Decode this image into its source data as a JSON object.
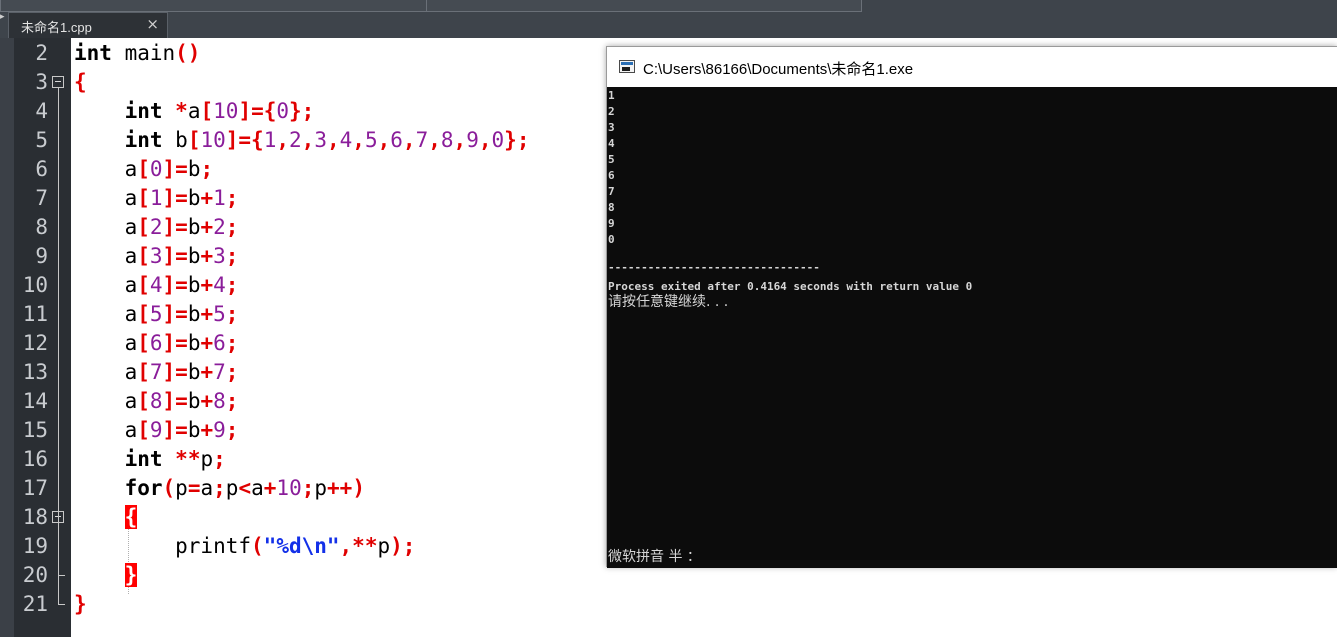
{
  "tab": {
    "label": "未命名1.cpp",
    "close": "×",
    "arrow": "▸"
  },
  "editor": {
    "line_numbers": [
      "2",
      "3",
      "4",
      "5",
      "6",
      "7",
      "8",
      "9",
      "10",
      "11",
      "12",
      "13",
      "14",
      "15",
      "16",
      "17",
      "18",
      "19",
      "20",
      "21"
    ],
    "lines": [
      [
        {
          "t": "int",
          "c": "kw"
        },
        {
          "t": " main",
          "c": ""
        },
        {
          "t": "()",
          "c": "sym"
        }
      ],
      [
        {
          "t": "{",
          "c": "sym"
        }
      ],
      [
        {
          "t": "    ",
          "c": ""
        },
        {
          "t": "int",
          "c": "kw"
        },
        {
          "t": " ",
          "c": ""
        },
        {
          "t": "*",
          "c": "sym"
        },
        {
          "t": "a",
          "c": ""
        },
        {
          "t": "[",
          "c": "sym"
        },
        {
          "t": "10",
          "c": "num"
        },
        {
          "t": "]={",
          "c": "sym"
        },
        {
          "t": "0",
          "c": "num"
        },
        {
          "t": "};",
          "c": "sym"
        }
      ],
      [
        {
          "t": "    ",
          "c": ""
        },
        {
          "t": "int",
          "c": "kw"
        },
        {
          "t": " b",
          "c": ""
        },
        {
          "t": "[",
          "c": "sym"
        },
        {
          "t": "10",
          "c": "num"
        },
        {
          "t": "]={",
          "c": "sym"
        },
        {
          "t": "1",
          "c": "num"
        },
        {
          "t": ",",
          "c": "sym"
        },
        {
          "t": "2",
          "c": "num"
        },
        {
          "t": ",",
          "c": "sym"
        },
        {
          "t": "3",
          "c": "num"
        },
        {
          "t": ",",
          "c": "sym"
        },
        {
          "t": "4",
          "c": "num"
        },
        {
          "t": ",",
          "c": "sym"
        },
        {
          "t": "5",
          "c": "num"
        },
        {
          "t": ",",
          "c": "sym"
        },
        {
          "t": "6",
          "c": "num"
        },
        {
          "t": ",",
          "c": "sym"
        },
        {
          "t": "7",
          "c": "num"
        },
        {
          "t": ",",
          "c": "sym"
        },
        {
          "t": "8",
          "c": "num"
        },
        {
          "t": ",",
          "c": "sym"
        },
        {
          "t": "9",
          "c": "num"
        },
        {
          "t": ",",
          "c": "sym"
        },
        {
          "t": "0",
          "c": "num"
        },
        {
          "t": "};",
          "c": "sym"
        }
      ],
      [
        {
          "t": "    a",
          "c": ""
        },
        {
          "t": "[",
          "c": "sym"
        },
        {
          "t": "0",
          "c": "num"
        },
        {
          "t": "]=",
          "c": "sym"
        },
        {
          "t": "b",
          "c": ""
        },
        {
          "t": ";",
          "c": "sym"
        }
      ],
      [
        {
          "t": "    a",
          "c": ""
        },
        {
          "t": "[",
          "c": "sym"
        },
        {
          "t": "1",
          "c": "num"
        },
        {
          "t": "]=",
          "c": "sym"
        },
        {
          "t": "b",
          "c": ""
        },
        {
          "t": "+",
          "c": "sym"
        },
        {
          "t": "1",
          "c": "num"
        },
        {
          "t": ";",
          "c": "sym"
        }
      ],
      [
        {
          "t": "    a",
          "c": ""
        },
        {
          "t": "[",
          "c": "sym"
        },
        {
          "t": "2",
          "c": "num"
        },
        {
          "t": "]=",
          "c": "sym"
        },
        {
          "t": "b",
          "c": ""
        },
        {
          "t": "+",
          "c": "sym"
        },
        {
          "t": "2",
          "c": "num"
        },
        {
          "t": ";",
          "c": "sym"
        }
      ],
      [
        {
          "t": "    a",
          "c": ""
        },
        {
          "t": "[",
          "c": "sym"
        },
        {
          "t": "3",
          "c": "num"
        },
        {
          "t": "]=",
          "c": "sym"
        },
        {
          "t": "b",
          "c": ""
        },
        {
          "t": "+",
          "c": "sym"
        },
        {
          "t": "3",
          "c": "num"
        },
        {
          "t": ";",
          "c": "sym"
        }
      ],
      [
        {
          "t": "    a",
          "c": ""
        },
        {
          "t": "[",
          "c": "sym"
        },
        {
          "t": "4",
          "c": "num"
        },
        {
          "t": "]=",
          "c": "sym"
        },
        {
          "t": "b",
          "c": ""
        },
        {
          "t": "+",
          "c": "sym"
        },
        {
          "t": "4",
          "c": "num"
        },
        {
          "t": ";",
          "c": "sym"
        }
      ],
      [
        {
          "t": "    a",
          "c": ""
        },
        {
          "t": "[",
          "c": "sym"
        },
        {
          "t": "5",
          "c": "num"
        },
        {
          "t": "]=",
          "c": "sym"
        },
        {
          "t": "b",
          "c": ""
        },
        {
          "t": "+",
          "c": "sym"
        },
        {
          "t": "5",
          "c": "num"
        },
        {
          "t": ";",
          "c": "sym"
        }
      ],
      [
        {
          "t": "    a",
          "c": ""
        },
        {
          "t": "[",
          "c": "sym"
        },
        {
          "t": "6",
          "c": "num"
        },
        {
          "t": "]=",
          "c": "sym"
        },
        {
          "t": "b",
          "c": ""
        },
        {
          "t": "+",
          "c": "sym"
        },
        {
          "t": "6",
          "c": "num"
        },
        {
          "t": ";",
          "c": "sym"
        }
      ],
      [
        {
          "t": "    a",
          "c": ""
        },
        {
          "t": "[",
          "c": "sym"
        },
        {
          "t": "7",
          "c": "num"
        },
        {
          "t": "]=",
          "c": "sym"
        },
        {
          "t": "b",
          "c": ""
        },
        {
          "t": "+",
          "c": "sym"
        },
        {
          "t": "7",
          "c": "num"
        },
        {
          "t": ";",
          "c": "sym"
        }
      ],
      [
        {
          "t": "    a",
          "c": ""
        },
        {
          "t": "[",
          "c": "sym"
        },
        {
          "t": "8",
          "c": "num"
        },
        {
          "t": "]=",
          "c": "sym"
        },
        {
          "t": "b",
          "c": ""
        },
        {
          "t": "+",
          "c": "sym"
        },
        {
          "t": "8",
          "c": "num"
        },
        {
          "t": ";",
          "c": "sym"
        }
      ],
      [
        {
          "t": "    a",
          "c": ""
        },
        {
          "t": "[",
          "c": "sym"
        },
        {
          "t": "9",
          "c": "num"
        },
        {
          "t": "]=",
          "c": "sym"
        },
        {
          "t": "b",
          "c": ""
        },
        {
          "t": "+",
          "c": "sym"
        },
        {
          "t": "9",
          "c": "num"
        },
        {
          "t": ";",
          "c": "sym"
        }
      ],
      [
        {
          "t": "    ",
          "c": ""
        },
        {
          "t": "int",
          "c": "kw"
        },
        {
          "t": " ",
          "c": ""
        },
        {
          "t": "**",
          "c": "sym"
        },
        {
          "t": "p",
          "c": ""
        },
        {
          "t": ";",
          "c": "sym"
        }
      ],
      [
        {
          "t": "    ",
          "c": ""
        },
        {
          "t": "for",
          "c": "kw"
        },
        {
          "t": "(",
          "c": "sym"
        },
        {
          "t": "p",
          "c": ""
        },
        {
          "t": "=",
          "c": "sym"
        },
        {
          "t": "a",
          "c": ""
        },
        {
          "t": ";",
          "c": "sym"
        },
        {
          "t": "p",
          "c": ""
        },
        {
          "t": "<",
          "c": "sym"
        },
        {
          "t": "a",
          "c": ""
        },
        {
          "t": "+",
          "c": "sym"
        },
        {
          "t": "10",
          "c": "num"
        },
        {
          "t": ";",
          "c": "sym"
        },
        {
          "t": "p",
          "c": ""
        },
        {
          "t": "++)",
          "c": "sym"
        }
      ],
      [
        {
          "t": "    ",
          "c": ""
        },
        {
          "t": "{",
          "c": "hl"
        }
      ],
      [
        {
          "t": "        printf",
          "c": ""
        },
        {
          "t": "(",
          "c": "sym"
        },
        {
          "t": "\"%d\\n\"",
          "c": "str"
        },
        {
          "t": ",**",
          "c": "sym"
        },
        {
          "t": "p",
          "c": ""
        },
        {
          "t": ");",
          "c": "sym"
        }
      ],
      [
        {
          "t": "    ",
          "c": ""
        },
        {
          "t": "}",
          "c": "hl"
        }
      ],
      [
        {
          "t": "}",
          "c": "sym"
        }
      ]
    ]
  },
  "console": {
    "title": "C:\\Users\\86166\\Documents\\未命名1.exe",
    "output_lines": [
      "1",
      "2",
      "3",
      "4",
      "5",
      "6",
      "7",
      "8",
      "9",
      "0"
    ],
    "separator": "--------------------------------",
    "process_exit": "Process exited after 0.4164 seconds with return value 0",
    "press_any_key": "请按任意键继续. . .",
    "ime_status": "微软拼音 半 ："
  }
}
